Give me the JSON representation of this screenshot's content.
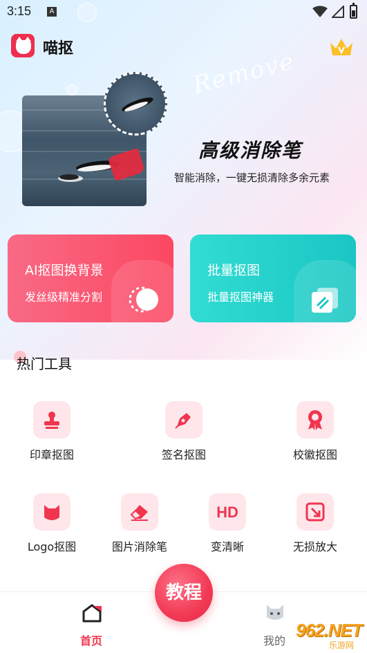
{
  "status_bar": {
    "time": "3:15",
    "notification_icon": "A"
  },
  "header": {
    "app_name": "喵抠",
    "logo_icon": "cat-logo-icon",
    "vip_icon": "crown-icon"
  },
  "banner": {
    "script_text": "Remove",
    "heading": "高级消除笔",
    "subheading": "智能消除，一键无损清除多余元素"
  },
  "feature_cards": [
    {
      "title": "AI抠图换背景",
      "subtitle": "发丝级精准分割",
      "color": "#fb4762",
      "icon": "toggle-circle-icon"
    },
    {
      "title": "批量抠图",
      "subtitle": "批量抠图神器",
      "color": "#1ac6c3",
      "icon": "stacked-pages-icon"
    }
  ],
  "tools_section": {
    "title": "热门工具",
    "row1": [
      {
        "label": "印章抠图",
        "icon": "stamp-icon"
      },
      {
        "label": "签名抠图",
        "icon": "pen-icon"
      },
      {
        "label": "校徽抠图",
        "icon": "badge-icon"
      }
    ],
    "row2": [
      {
        "label": "Logo抠图",
        "icon": "cat-head-icon"
      },
      {
        "label": "图片消除笔",
        "icon": "eraser-icon"
      },
      {
        "label": "变清晰",
        "icon": "hd-icon",
        "icon_text": "HD"
      },
      {
        "label": "无损放大",
        "icon": "enlarge-icon"
      }
    ]
  },
  "bottom_nav": {
    "home_label": "首页",
    "me_label": "我的",
    "tutorial_label": "教程"
  },
  "watermark": {
    "main": "962.NET",
    "sub": "乐游网"
  },
  "colors": {
    "brand_red": "#f0354f",
    "teal": "#1ac6c3",
    "icon_bg": "#ffe6ea"
  }
}
